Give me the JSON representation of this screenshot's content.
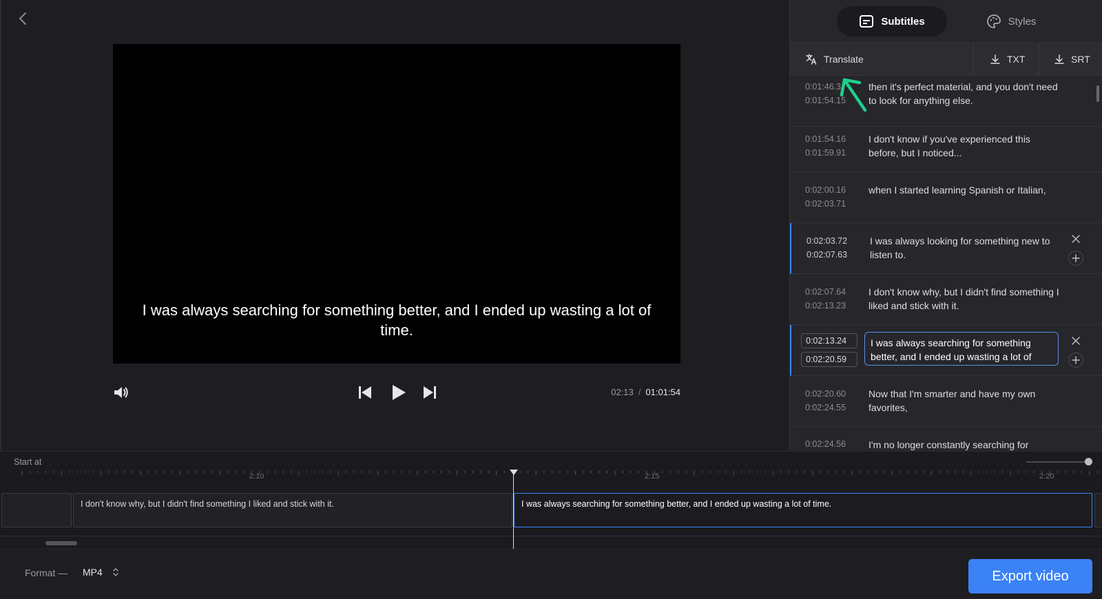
{
  "player": {
    "caption": "I was always searching for something better, and I ended up wasting a lot of time.",
    "current_time": "02:13",
    "time_separator": "/",
    "total_time": "01:01:54"
  },
  "panel": {
    "tabs": [
      {
        "label": "Subtitles",
        "icon": "subtitles-icon",
        "active": true
      },
      {
        "label": "Styles",
        "icon": "palette-icon",
        "active": false
      }
    ],
    "toolbar": {
      "translate_label": "Translate",
      "txt_label": "TXT",
      "srt_label": "SRT"
    },
    "subtitles": [
      {
        "start": "0:01:46.3",
        "end": "0:01:54.15",
        "text": "then it's perfect material, and you don't need to look for anything else."
      },
      {
        "start": "0:01:54.16",
        "end": "0:01:59.91",
        "text": "I don't know if you've experienced this before, but I noticed..."
      },
      {
        "start": "0:02:00.16",
        "end": "0:02:03.71",
        "text": "when I started learning Spanish or Italian,"
      },
      {
        "start": "0:02:03.72",
        "end": "0:02:07.63",
        "text": "I was always looking for something new to listen to."
      },
      {
        "start": "0:02:07.64",
        "end": "0:02:13.23",
        "text": "I don't know why, but I didn't find something I liked and stick with it."
      },
      {
        "start": "0:02:13.24",
        "end": "0:02:20.59",
        "text": "I was always searching for something better, and I ended up wasting a lot of"
      },
      {
        "start": "0:02:20.60",
        "end": "0:02:24.55",
        "text": "Now that I'm smarter and have my own favorites,"
      },
      {
        "start": "0:02:24.56",
        "end": "",
        "text": "I'm no longer constantly searching for"
      }
    ]
  },
  "timeline": {
    "start_at_label": "Start at",
    "ruler_labels": [
      "2:10",
      "2:15",
      "2:20"
    ],
    "clips": [
      {
        "text": ""
      },
      {
        "text": "I don't know why, but I didn't find something I liked and stick with it."
      },
      {
        "text": "I was always searching for something better, and I ended up wasting a lot of time."
      },
      {
        "text": ""
      }
    ]
  },
  "footer": {
    "format_label": "Format —",
    "format_value": "MP4",
    "export_label": "Export video"
  },
  "colors": {
    "accent": "#3b82f6",
    "annotation": "#1fd08a",
    "background": "#1e1e22",
    "panel": "#26262b"
  }
}
